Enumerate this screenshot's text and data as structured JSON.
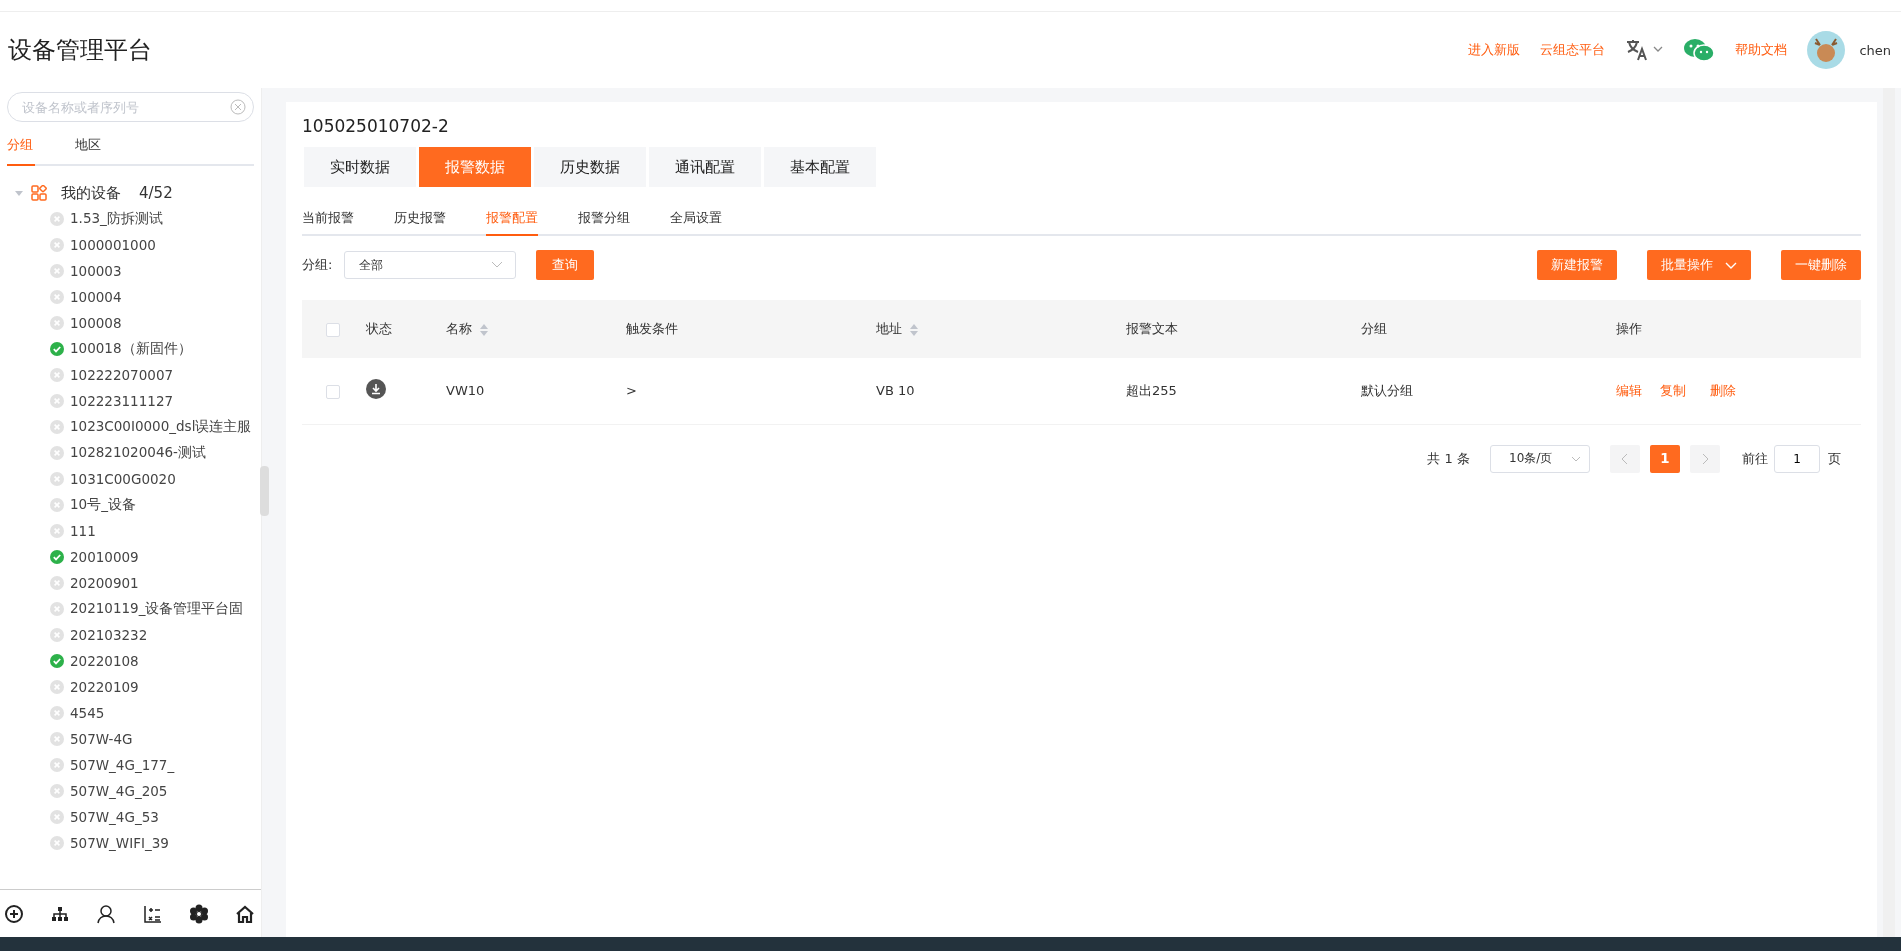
{
  "header": {
    "title": "设备管理平台",
    "links": [
      {
        "label": "进入新版"
      },
      {
        "label": "云组态平台"
      }
    ],
    "help": "帮助文档",
    "user": "chen"
  },
  "sidebar": {
    "search": {
      "placeholder": "设备名称或者序列号"
    },
    "tabs": [
      {
        "label": "分组",
        "selected": true
      },
      {
        "label": "地区",
        "selected": false
      }
    ],
    "tree": {
      "label": "我的设备",
      "count": "4/52",
      "expanded": true,
      "children": [
        {
          "label": "1.53_防拆测试",
          "online": false
        },
        {
          "label": "1000001000",
          "online": false
        },
        {
          "label": "100003",
          "online": false
        },
        {
          "label": "100004",
          "online": false
        },
        {
          "label": "100008",
          "online": false
        },
        {
          "label": "100018（新固件）",
          "online": true
        },
        {
          "label": "102222070007",
          "online": false
        },
        {
          "label": "102223111127",
          "online": false
        },
        {
          "label": "1023C00I0000_dsl误连主服",
          "online": false
        },
        {
          "label": "102821020046-测试",
          "online": false
        },
        {
          "label": "1031C00G0020",
          "online": false
        },
        {
          "label": "10号_设备",
          "online": false
        },
        {
          "label": "111",
          "online": false
        },
        {
          "label": "20010009",
          "online": true
        },
        {
          "label": "20200901",
          "online": false
        },
        {
          "label": "20210119_设备管理平台固",
          "online": false
        },
        {
          "label": "202103232",
          "online": false
        },
        {
          "label": "20220108",
          "online": true
        },
        {
          "label": "20220109",
          "online": false
        },
        {
          "label": "4545",
          "online": false
        },
        {
          "label": "507W-4G",
          "online": false
        },
        {
          "label": "507W_4G_177_",
          "online": false
        },
        {
          "label": "507W_4G_205",
          "online": false
        },
        {
          "label": "507W_4G_53",
          "online": false
        },
        {
          "label": "507W_WIFI_39",
          "online": false
        }
      ]
    }
  },
  "main": {
    "device": "105025010702-2",
    "tabs": [
      {
        "label": "实时数据",
        "selected": false
      },
      {
        "label": "报警数据",
        "selected": true
      },
      {
        "label": "历史数据",
        "selected": false
      },
      {
        "label": "通讯配置",
        "selected": false
      },
      {
        "label": "基本配置",
        "selected": false
      }
    ],
    "subtabs": [
      {
        "label": "当前报警",
        "selected": false
      },
      {
        "label": "历史报警",
        "selected": false
      },
      {
        "label": "报警配置",
        "selected": true
      },
      {
        "label": "报警分组",
        "selected": false
      },
      {
        "label": "全局设置",
        "selected": false
      }
    ],
    "filter": {
      "label": "分组:",
      "value": "全部",
      "button": "查询"
    },
    "actions": [
      {
        "label": "新建报警",
        "dropdown": false
      },
      {
        "label": "批量操作",
        "dropdown": true
      },
      {
        "label": "一键删除",
        "dropdown": false
      }
    ],
    "table": {
      "columns": [
        {
          "label": "状态",
          "sortable": false
        },
        {
          "label": "名称",
          "sortable": true
        },
        {
          "label": "触发条件",
          "sortable": false
        },
        {
          "label": "地址",
          "sortable": true
        },
        {
          "label": "报警文本",
          "sortable": false
        },
        {
          "label": "分组",
          "sortable": false
        },
        {
          "label": "操作",
          "sortable": false
        }
      ],
      "all_checked": false,
      "rows": [
        {
          "checked": false,
          "cells": [
            "",
            "VW10",
            ">",
            "VB 10",
            "超出255",
            "默认分组"
          ],
          "ops": [
            "编辑",
            "复制",
            "删除"
          ]
        }
      ]
    },
    "pagination": {
      "total": "共 1 条",
      "page_size": "10条/页",
      "pages": [
        {
          "label": "1",
          "selected": true
        }
      ],
      "goto_label": "前往",
      "goto_value": "1",
      "goto_suffix": "页"
    }
  }
}
